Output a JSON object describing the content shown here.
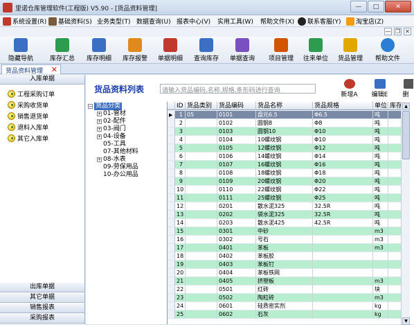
{
  "window": {
    "title": "里诺仓库管理软件(工程版) V5.90 - [货品资料管理]",
    "min_label": "—",
    "max_label": "□",
    "close_label": "✕"
  },
  "menu": {
    "items": [
      {
        "label": "系统设置(R)"
      },
      {
        "label": "基础资料(S)"
      },
      {
        "label": "业务类型(T)"
      },
      {
        "label": "数据查询(U)"
      },
      {
        "label": "报表中心(V)"
      },
      {
        "label": "实用工具(W)"
      },
      {
        "label": "帮助文件(X)"
      },
      {
        "label": "联系客服(Y)"
      },
      {
        "label": "淘宝店(Z)"
      }
    ],
    "mdi_min": "—",
    "mdi_restore": "❐",
    "mdi_close": "✕"
  },
  "toolbar": {
    "buttons": [
      {
        "label": "隐藏导航",
        "color": "#3b6fc4"
      },
      {
        "label": "库存汇总",
        "color": "#2d9c4f"
      },
      {
        "label": "库存明细",
        "color": "#3b6fc4"
      },
      {
        "label": "库存报警",
        "color": "#e08a1e"
      },
      {
        "label": "单据明细",
        "color": "#c0392b"
      },
      {
        "label": "查询库存",
        "color": "#3b6fc4"
      },
      {
        "label": "单据查询",
        "color": "#7a4fbf"
      },
      {
        "label": "项目管理",
        "color": "#d35400"
      },
      {
        "label": "往来单位",
        "color": "#2d9c4f"
      },
      {
        "label": "货品管理",
        "color": "#e0a800"
      },
      {
        "label": "帮助文件",
        "color": "#2a7fd4"
      }
    ]
  },
  "tab": {
    "label": "货品资料管理",
    "close_label": "✕"
  },
  "left_panel": {
    "header_in": "入库单据",
    "items": [
      {
        "label": "工程采购订单"
      },
      {
        "label": "采购收货单"
      },
      {
        "label": "销售退货单"
      },
      {
        "label": "退料入库单"
      },
      {
        "label": "其它入库单"
      }
    ],
    "bottom_headers": [
      {
        "label": "出库单据"
      },
      {
        "label": "其它单据"
      },
      {
        "label": "销售报表"
      },
      {
        "label": "采购报表"
      }
    ]
  },
  "main": {
    "title": "货品资料列表",
    "search_placeholder": "请输入货品编码,名称,规格,条形码进行查询",
    "actions": [
      {
        "label": "新增A",
        "color": "#c0392b"
      },
      {
        "label": "编辑E",
        "color": "#3b6fc4"
      },
      {
        "label": "删",
        "color": "#555555"
      }
    ]
  },
  "tree": {
    "root": "货品分类",
    "nodes": [
      {
        "label": "01-管材",
        "expandable": true
      },
      {
        "label": "02-配件",
        "expandable": true
      },
      {
        "label": "03-阀门",
        "expandable": true
      },
      {
        "label": "04-设备",
        "expandable": true
      },
      {
        "label": "05-工具",
        "expandable": false
      },
      {
        "label": "07-其他材料",
        "expandable": false
      },
      {
        "label": "08-水表",
        "expandable": true
      },
      {
        "label": "09-劳保用品",
        "expandable": false
      },
      {
        "label": "10-办公用品",
        "expandable": false
      }
    ]
  },
  "grid": {
    "columns": [
      "ID",
      "货品类别",
      "货品编码",
      "货品名称",
      "货品规格",
      "单位",
      "库存"
    ],
    "rows": [
      {
        "id": "1",
        "cat": "05",
        "code": "0101",
        "name": "盘元6.5",
        "spec": "Φ6.5",
        "unit": "吨"
      },
      {
        "id": "2",
        "cat": "",
        "code": "0102",
        "name": "圆钢8",
        "spec": "Φ8",
        "unit": "吨"
      },
      {
        "id": "3",
        "cat": "",
        "code": "0103",
        "name": "圆钢10",
        "spec": "Φ10",
        "unit": "吨"
      },
      {
        "id": "4",
        "cat": "",
        "code": "0104",
        "name": "10螺纹钢",
        "spec": "Φ10",
        "unit": "吨"
      },
      {
        "id": "5",
        "cat": "",
        "code": "0105",
        "name": "12螺纹钢",
        "spec": "Φ12",
        "unit": "吨"
      },
      {
        "id": "6",
        "cat": "",
        "code": "0106",
        "name": "14螺纹钢",
        "spec": "Φ14",
        "unit": "吨"
      },
      {
        "id": "7",
        "cat": "",
        "code": "0107",
        "name": "16螺纹钢",
        "spec": "Φ16",
        "unit": "吨"
      },
      {
        "id": "8",
        "cat": "",
        "code": "0108",
        "name": "18螺纹钢",
        "spec": "Φ18",
        "unit": "吨"
      },
      {
        "id": "9",
        "cat": "",
        "code": "0109",
        "name": "20螺纹钢",
        "spec": "Φ20",
        "unit": "吨"
      },
      {
        "id": "10",
        "cat": "",
        "code": "0110",
        "name": "22螺纹钢",
        "spec": "Φ22",
        "unit": "吨"
      },
      {
        "id": "11",
        "cat": "",
        "code": "0111",
        "name": "25螺纹钢",
        "spec": "Φ25",
        "unit": "吨"
      },
      {
        "id": "12",
        "cat": "",
        "code": "0201",
        "name": "散水泥325",
        "spec": "32.5R",
        "unit": "吨"
      },
      {
        "id": "13",
        "cat": "",
        "code": "0202",
        "name": "袋水泥325",
        "spec": "32.5R",
        "unit": "吨"
      },
      {
        "id": "14",
        "cat": "",
        "code": "0203",
        "name": "散水泥425",
        "spec": "42.5R",
        "unit": "吨"
      },
      {
        "id": "15",
        "cat": "",
        "code": "0301",
        "name": "中砂",
        "spec": "",
        "unit": "m3"
      },
      {
        "id": "16",
        "cat": "",
        "code": "0302",
        "name": "号石",
        "spec": "",
        "unit": "m3"
      },
      {
        "id": "17",
        "cat": "",
        "code": "0401",
        "name": "苯板",
        "spec": "",
        "unit": "m3"
      },
      {
        "id": "18",
        "cat": "",
        "code": "0402",
        "name": "苯板胶",
        "spec": "",
        "unit": ""
      },
      {
        "id": "19",
        "cat": "",
        "code": "0403",
        "name": "苯板钉",
        "spec": "",
        "unit": ""
      },
      {
        "id": "20",
        "cat": "",
        "code": "0404",
        "name": "苯板铁网",
        "spec": "",
        "unit": ""
      },
      {
        "id": "21",
        "cat": "",
        "code": "0405",
        "name": "挤塑板",
        "spec": "",
        "unit": "m3"
      },
      {
        "id": "22",
        "cat": "",
        "code": "0501",
        "name": "红砖",
        "spec": "",
        "unit": "块"
      },
      {
        "id": "23",
        "cat": "",
        "code": "0502",
        "name": "陶粒砖",
        "spec": "",
        "unit": "m3"
      },
      {
        "id": "24",
        "cat": "",
        "code": "0601",
        "name": "硅质密实剂",
        "spec": "",
        "unit": "kg"
      },
      {
        "id": "25",
        "cat": "",
        "code": "0602",
        "name": "石灰",
        "spec": "",
        "unit": "kg"
      }
    ],
    "scroll_up": "▲",
    "scroll_down": "▼"
  }
}
